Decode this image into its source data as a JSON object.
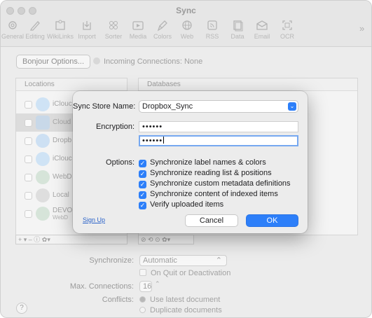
{
  "window": {
    "title": "Sync"
  },
  "toolbar": {
    "items": [
      {
        "label": "General",
        "icon": "gear-icon"
      },
      {
        "label": "Editing",
        "icon": "pen-icon"
      },
      {
        "label": "WikiLinks",
        "icon": "puzzle-icon"
      },
      {
        "label": "Import",
        "icon": "import-icon"
      },
      {
        "label": "Sorter",
        "icon": "sorter-icon"
      },
      {
        "label": "Media",
        "icon": "media-icon"
      },
      {
        "label": "Colors",
        "icon": "brush-icon"
      },
      {
        "label": "Web",
        "icon": "globe-icon"
      },
      {
        "label": "RSS",
        "icon": "rss-icon"
      },
      {
        "label": "Data",
        "icon": "data-icon"
      },
      {
        "label": "Email",
        "icon": "email-icon"
      },
      {
        "label": "OCR",
        "icon": "ocr-icon"
      }
    ],
    "more": "»"
  },
  "background": {
    "bonjour_button": "Bonjour Options...",
    "incoming": "Incoming Connections: None",
    "locations_header": "Locations",
    "databases_header": "Databases",
    "locations": [
      {
        "label": "iClouc",
        "sub": ""
      },
      {
        "label": "Cloud",
        "sub": ""
      },
      {
        "label": "Dropb",
        "sub": ""
      },
      {
        "label": "iClouc",
        "sub": ""
      },
      {
        "label": "WebD",
        "sub": ""
      },
      {
        "label": "Local",
        "sub": ""
      },
      {
        "label": "DEVO",
        "sub": "WebD"
      }
    ],
    "left_bar": "+ ▾  –  ⓘ ✿▾",
    "right_bar": "⊘  ⟲  ⊙  ✿▾",
    "synchronize_label": "Synchronize:",
    "synchronize_value": "Automatic",
    "on_quit": "On Quit or Deactivation",
    "max_connections_label": "Max. Connections:",
    "max_connections_value": "16",
    "conflicts_label": "Conflicts:",
    "conflict_options": [
      "Use latest document",
      "Duplicate documents"
    ],
    "help": "?"
  },
  "sheet": {
    "store_name_label": "Sync Store Name:",
    "store_name_value": "Dropbox_Sync",
    "encryption_label": "Encryption:",
    "encryption_value": "••••••",
    "encryption_confirm": "••••••",
    "options_label": "Options:",
    "options": [
      "Synchronize label names & colors",
      "Synchronize reading list & positions",
      "Synchronize custom metadata definitions",
      "Synchronize content of indexed items",
      "Verify uploaded items"
    ],
    "signup": "Sign Up",
    "cancel": "Cancel",
    "ok": "OK",
    "accent": "#2d7ff9"
  }
}
